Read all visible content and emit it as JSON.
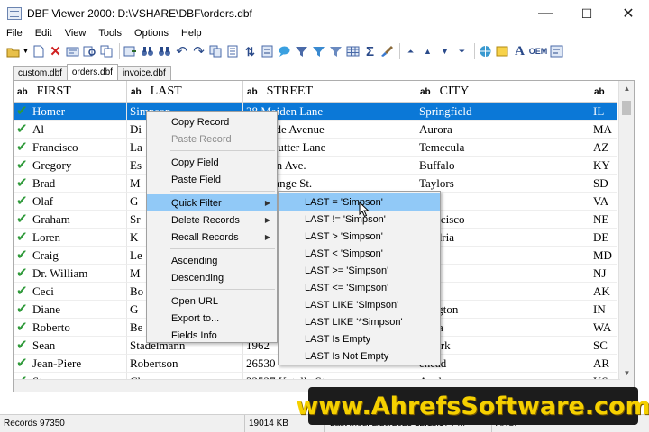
{
  "window": {
    "title": "DBF Viewer 2000: D:\\VSHARE\\DBF\\orders.dbf"
  },
  "window_buttons": {
    "minimize": "—",
    "maximize": "☐",
    "close": "✕"
  },
  "menu": [
    "File",
    "Edit",
    "View",
    "Tools",
    "Options",
    "Help"
  ],
  "toolbar": {
    "oem_label": "OEM"
  },
  "tabs": [
    {
      "label": "custom.dbf",
      "active": false
    },
    {
      "label": "orders.dbf",
      "active": true
    },
    {
      "label": "invoice.dbf",
      "active": false
    }
  ],
  "grid": {
    "type_badge": "ab",
    "columns": [
      "FIRST",
      "LAST",
      "STREET",
      "CITY",
      ""
    ],
    "rows": [
      [
        "Homer",
        "Simpson",
        "28 Maiden Lane",
        "Springfield",
        "IL"
      ],
      [
        "Al",
        "Di",
        "Parkside Avenue",
        "Aurora",
        "MA"
      ],
      [
        "Francisco",
        "La",
        "Stonecutter Lane",
        "Temecula",
        "AZ"
      ],
      [
        "Gregory",
        "Es",
        "Weldon Ave.",
        "Buffalo",
        "KY"
      ],
      [
        "Brad",
        "M",
        "W. Orange St.",
        "Taylors",
        "SD"
      ],
      [
        "Olaf",
        "G",
        "",
        "ina",
        "VA"
      ],
      [
        "Graham",
        "Sr",
        "",
        "Francisco",
        "NE"
      ],
      [
        "Loren",
        "K",
        "",
        "xandria",
        "DE"
      ],
      [
        "Craig",
        "Le",
        "",
        "land",
        "MD"
      ],
      [
        "Dr. William",
        "M",
        "",
        "den",
        "NJ"
      ],
      [
        "Ceci",
        "Bo",
        "",
        "mi",
        "AK"
      ],
      [
        "Diane",
        "G",
        "",
        "mington",
        "IN"
      ],
      [
        "Roberto",
        "Be",
        "",
        "rovia",
        "WA"
      ],
      [
        "Sean",
        "Stadelmann",
        "1962",
        "v York",
        "SC"
      ],
      [
        "Jean-Piere",
        "Robertson",
        "26530",
        "ehead",
        "AR"
      ],
      [
        "Steve",
        "Chang",
        "32527 Katella St.",
        "Anchorage",
        "KS"
      ]
    ]
  },
  "context_menu": [
    {
      "label": "Copy Record",
      "disabled": false,
      "submenu": false
    },
    {
      "label": "Paste Record",
      "disabled": true,
      "submenu": false
    },
    {
      "sep": true
    },
    {
      "label": "Copy Field",
      "disabled": false,
      "submenu": false
    },
    {
      "label": "Paste Field",
      "disabled": false,
      "submenu": false
    },
    {
      "sep": true
    },
    {
      "label": "Quick Filter",
      "disabled": false,
      "submenu": true,
      "highlighted": true
    },
    {
      "label": "Delete Records",
      "disabled": false,
      "submenu": true
    },
    {
      "label": "Recall Records",
      "disabled": false,
      "submenu": true
    },
    {
      "sep": true
    },
    {
      "label": "Ascending",
      "disabled": false,
      "submenu": false
    },
    {
      "label": "Descending",
      "disabled": false,
      "submenu": false
    },
    {
      "sep": true
    },
    {
      "label": "Open URL",
      "disabled": false,
      "submenu": false
    },
    {
      "label": "Export to...",
      "disabled": false,
      "submenu": false
    },
    {
      "label": "Fields Info",
      "disabled": false,
      "submenu": false
    }
  ],
  "quick_filter_menu": [
    "LAST = 'Simpson'",
    "LAST != 'Simpson'",
    "LAST > 'Simpson'",
    "LAST < 'Simpson'",
    "LAST >= 'Simpson'",
    "LAST <= 'Simpson'",
    "LAST LIKE 'Simpson'",
    "LAST LIKE '*Simpson'",
    "LAST Is Empty",
    "LAST Is Not Empty"
  ],
  "status": {
    "records": "Records 97350",
    "size": "19014 KB",
    "last_mod": "Last mod: 2/28/2023 12:11:17 PM",
    "encoding": "ANSI"
  },
  "watermark": "www.AhrefsSoftware.com",
  "colors": {
    "selection": "#0b78d7",
    "menu_highlight": "#91c9f7",
    "check": "#2f9a3a"
  }
}
